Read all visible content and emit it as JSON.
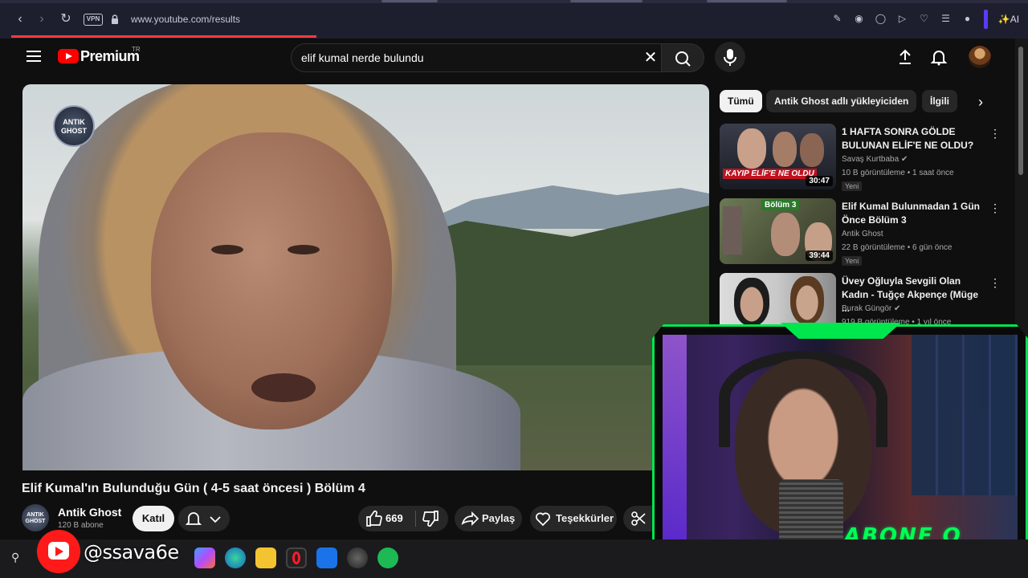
{
  "browser": {
    "url": "www.youtube.com/results",
    "vpn_label": "VPN",
    "ai_label": "AI"
  },
  "header": {
    "brand": "Premium",
    "country": "TR",
    "search_query": "elif kumal nerde bulundu"
  },
  "player": {
    "channel_logo_text": "ANTIK GHOST"
  },
  "video": {
    "title": "Elif Kumal'ın Bulunduğu Gün ( 4-5 saat öncesi ) Bölüm 4",
    "channel": "Antik Ghost",
    "subscribers": "120 B abone",
    "join_label": "Katıl",
    "likes": "669",
    "share_label": "Paylaş",
    "thanks_label": "Teşekkürler"
  },
  "chips": [
    "Tümü",
    "Antik Ghost adlı yükleyiciden",
    "İlgili"
  ],
  "recommendations": [
    {
      "title": "1 HAFTA SONRA GÖLDE BULUNAN ELİF'E NE OLDU?",
      "channel": "Savaş Kurtbaba",
      "meta": "10 B görüntüleme • 1 saat önce",
      "badge": "Yeni",
      "duration": "30:47",
      "thumb_text": "KAYIP ELİF'E NE OLDU"
    },
    {
      "title": "Elif Kumal Bulunmadan 1 Gün Önce Bölüm 3",
      "channel": "Antik Ghost",
      "meta": "22 B görüntüleme • 6 gün önce",
      "badge": "Yeni",
      "duration": "39:44",
      "thumb_text": "Bölüm 3"
    },
    {
      "title": "Üvey Oğluyla Sevgili Olan Kadın - Tuğçe Akpençe (Müge ...",
      "channel": "Burak Güngör",
      "meta": "919 B görüntüleme • 1 yıl önce",
      "badge": "",
      "duration": "",
      "thumb_text": ""
    }
  ],
  "overlay": {
    "handle": "@ssava6e",
    "abone": "ABONE O"
  },
  "colors": {
    "accent_red": "#ff0000",
    "overlay_green": "#00e64d"
  }
}
